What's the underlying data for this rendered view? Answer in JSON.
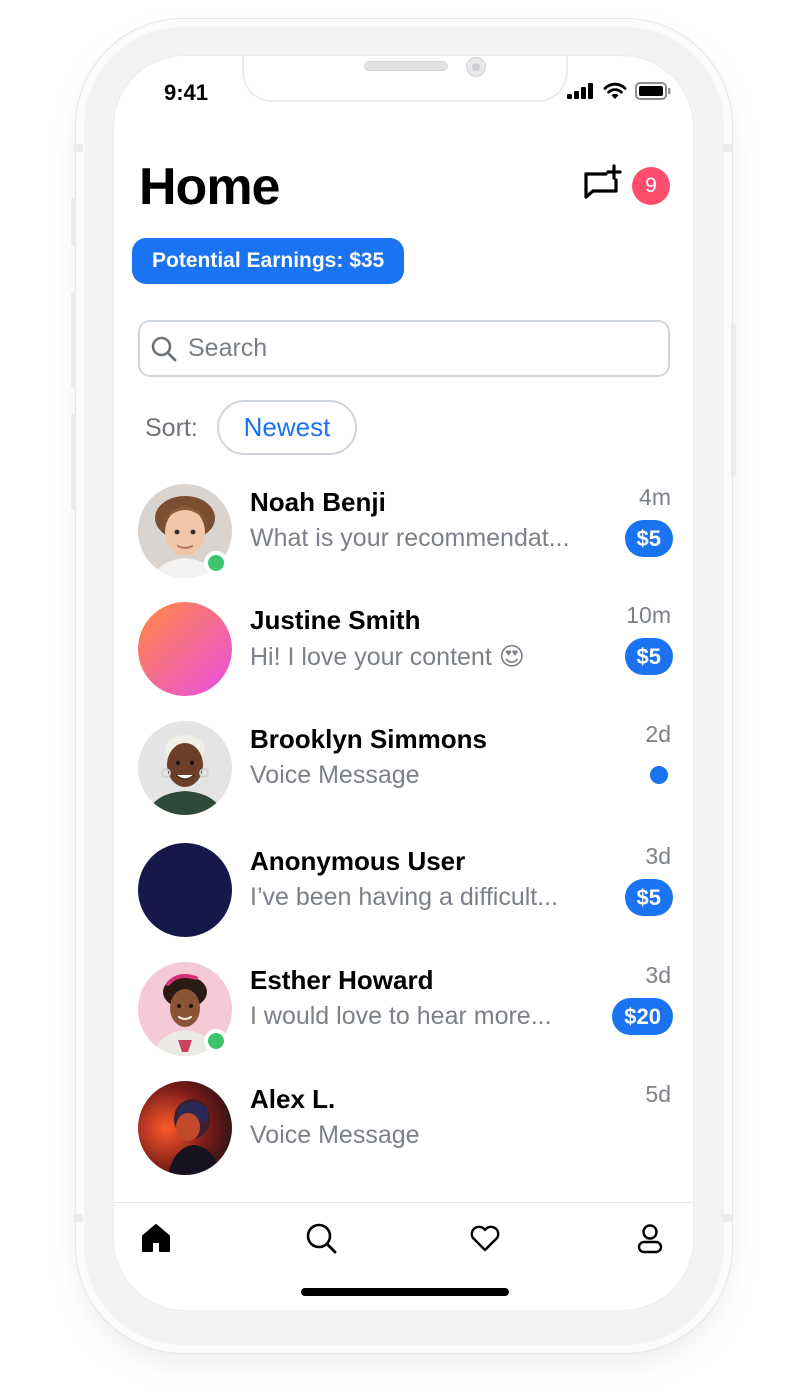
{
  "status_bar": {
    "time": "9:41"
  },
  "header": {
    "title": "Home",
    "unread_count": "9"
  },
  "earnings": {
    "label": "Potential Earnings: $35"
  },
  "search": {
    "placeholder": "Search"
  },
  "sort": {
    "label": "Sort:",
    "selected": "Newest"
  },
  "conversations": [
    {
      "name": "Noah Benji",
      "preview": "What is your recommendat...",
      "time": "4m",
      "price": "$5",
      "online": true
    },
    {
      "name": "Justine Smith",
      "preview": "Hi! I love your content 😍",
      "time": "10m",
      "price": "$5",
      "online": false
    },
    {
      "name": "Brooklyn Simmons",
      "preview": "Voice Message",
      "time": "2d",
      "price": "",
      "online": false,
      "unread": true
    },
    {
      "name": "Anonymous User",
      "preview": "I’ve been having a difficult...",
      "time": "3d",
      "price": "$5",
      "online": false
    },
    {
      "name": "Esther Howard",
      "preview": "I would love to hear more...",
      "time": "3d",
      "price": "$20",
      "online": true
    },
    {
      "name": "Alex L.",
      "preview": "Voice Message",
      "time": "5d",
      "price": "",
      "online": false
    }
  ],
  "tabs": [
    "home-icon",
    "search-icon",
    "heart-icon",
    "profile-icon"
  ],
  "colors": {
    "accent": "#1a73f0",
    "badge": "#ff4d6d",
    "online": "#3ec46d"
  }
}
